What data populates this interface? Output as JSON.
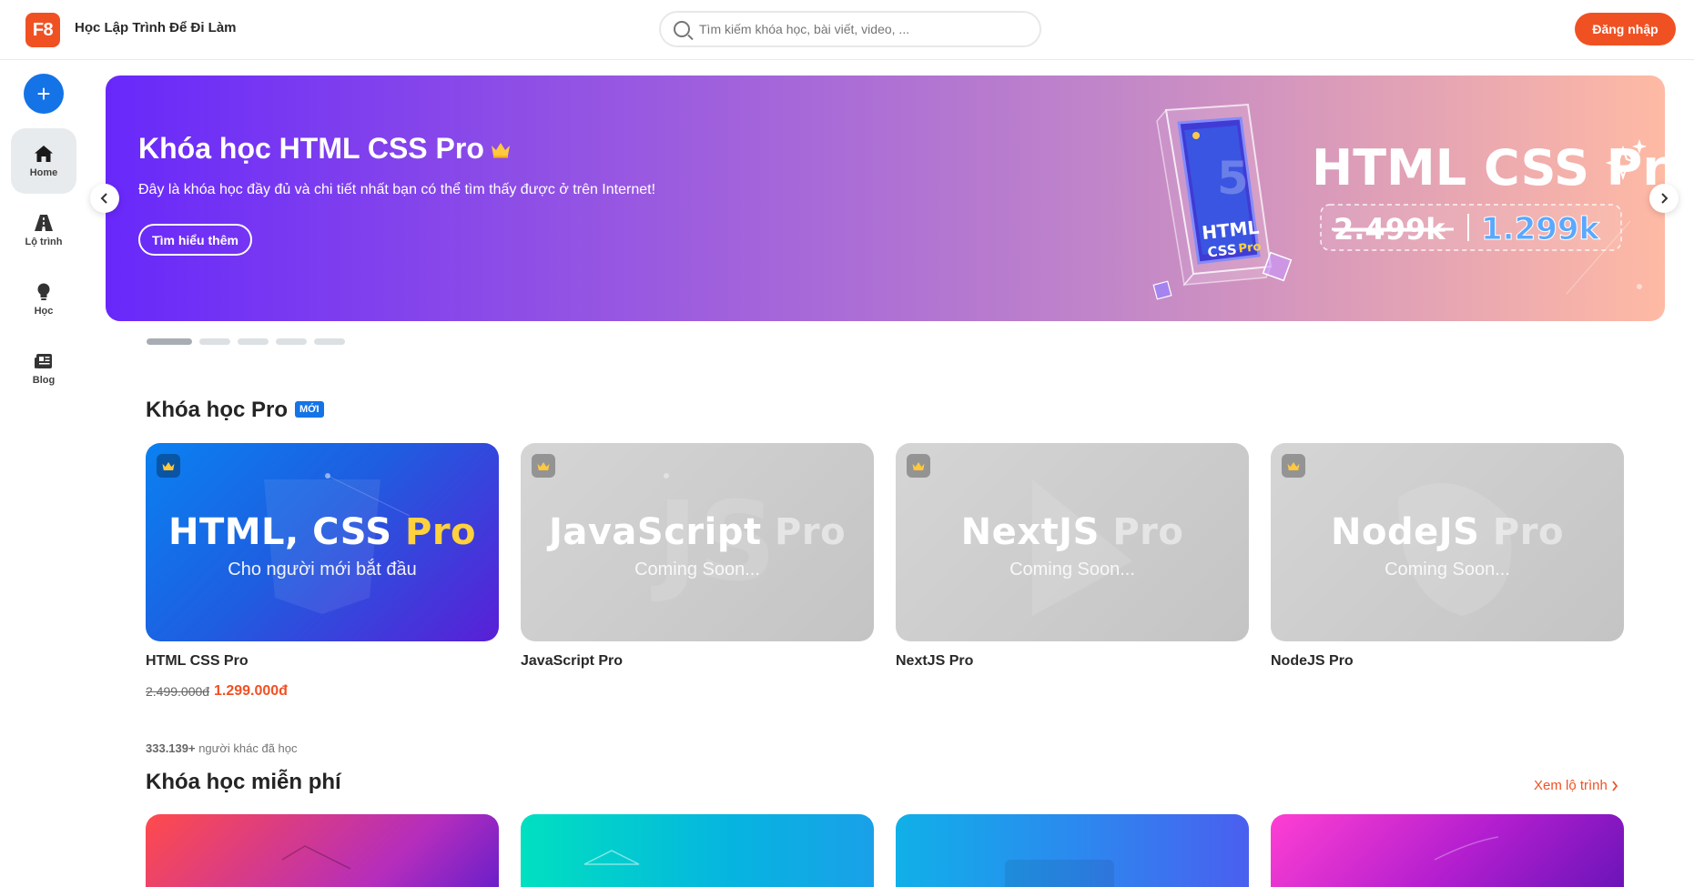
{
  "header": {
    "logo_text": "F8",
    "site_title": "Học Lập Trình Để Đi Làm",
    "search_placeholder": "Tìm kiếm khóa học, bài viết, video, ...",
    "login_label": "Đăng nhập"
  },
  "sidebar": {
    "create_symbol": "+",
    "items": [
      {
        "label": "Home",
        "icon": "home-icon",
        "active": true
      },
      {
        "label": "Lộ trình",
        "icon": "road-icon",
        "active": false
      },
      {
        "label": "Học",
        "icon": "lightbulb-icon",
        "active": false
      },
      {
        "label": "Blog",
        "icon": "newspaper-icon",
        "active": false
      }
    ]
  },
  "banner": {
    "title": "Khóa học HTML CSS Pro",
    "description": "Đây là khóa học đầy đủ và chi tiết nhất bạn có thể tìm thấy được ở trên Internet!",
    "button_label": "Tìm hiểu thêm",
    "graphic_title": "HTML CSS Pro",
    "graphic_old_price": "2.499k",
    "graphic_new_price": "1.299k",
    "book_line1": "HTML",
    "book_line2": "CSS",
    "book_line3": "Pro",
    "book_number": "5",
    "slide_count": 5,
    "active_slide": 1
  },
  "pro_section": {
    "title": "Khóa học Pro",
    "badge": "MỚI",
    "courses": [
      {
        "name": "HTML CSS Pro",
        "art_title": "HTML, CSS",
        "art_pro": "Pro",
        "art_sub": "Cho người mới bắt đầu",
        "old_price": "2.499.000đ",
        "new_price": "1.299.000đ"
      },
      {
        "name": "JavaScript Pro",
        "art_title": "JavaScript",
        "art_pro": "Pro",
        "art_sub": "Coming Soon..."
      },
      {
        "name": "NextJS Pro",
        "art_title": "NextJS",
        "art_pro": "Pro",
        "art_sub": "Coming Soon..."
      },
      {
        "name": "NodeJS Pro",
        "art_title": "NodeJS",
        "art_pro": "Pro",
        "art_sub": "Coming Soon..."
      }
    ]
  },
  "free_section": {
    "learners_count": "333.139+",
    "learners_text": " người khác đã học",
    "title": "Khóa học miễn phí",
    "view_path_label": "Xem lộ trình"
  },
  "colors": {
    "brand": "#f05123",
    "accent_blue": "#1473e6"
  }
}
